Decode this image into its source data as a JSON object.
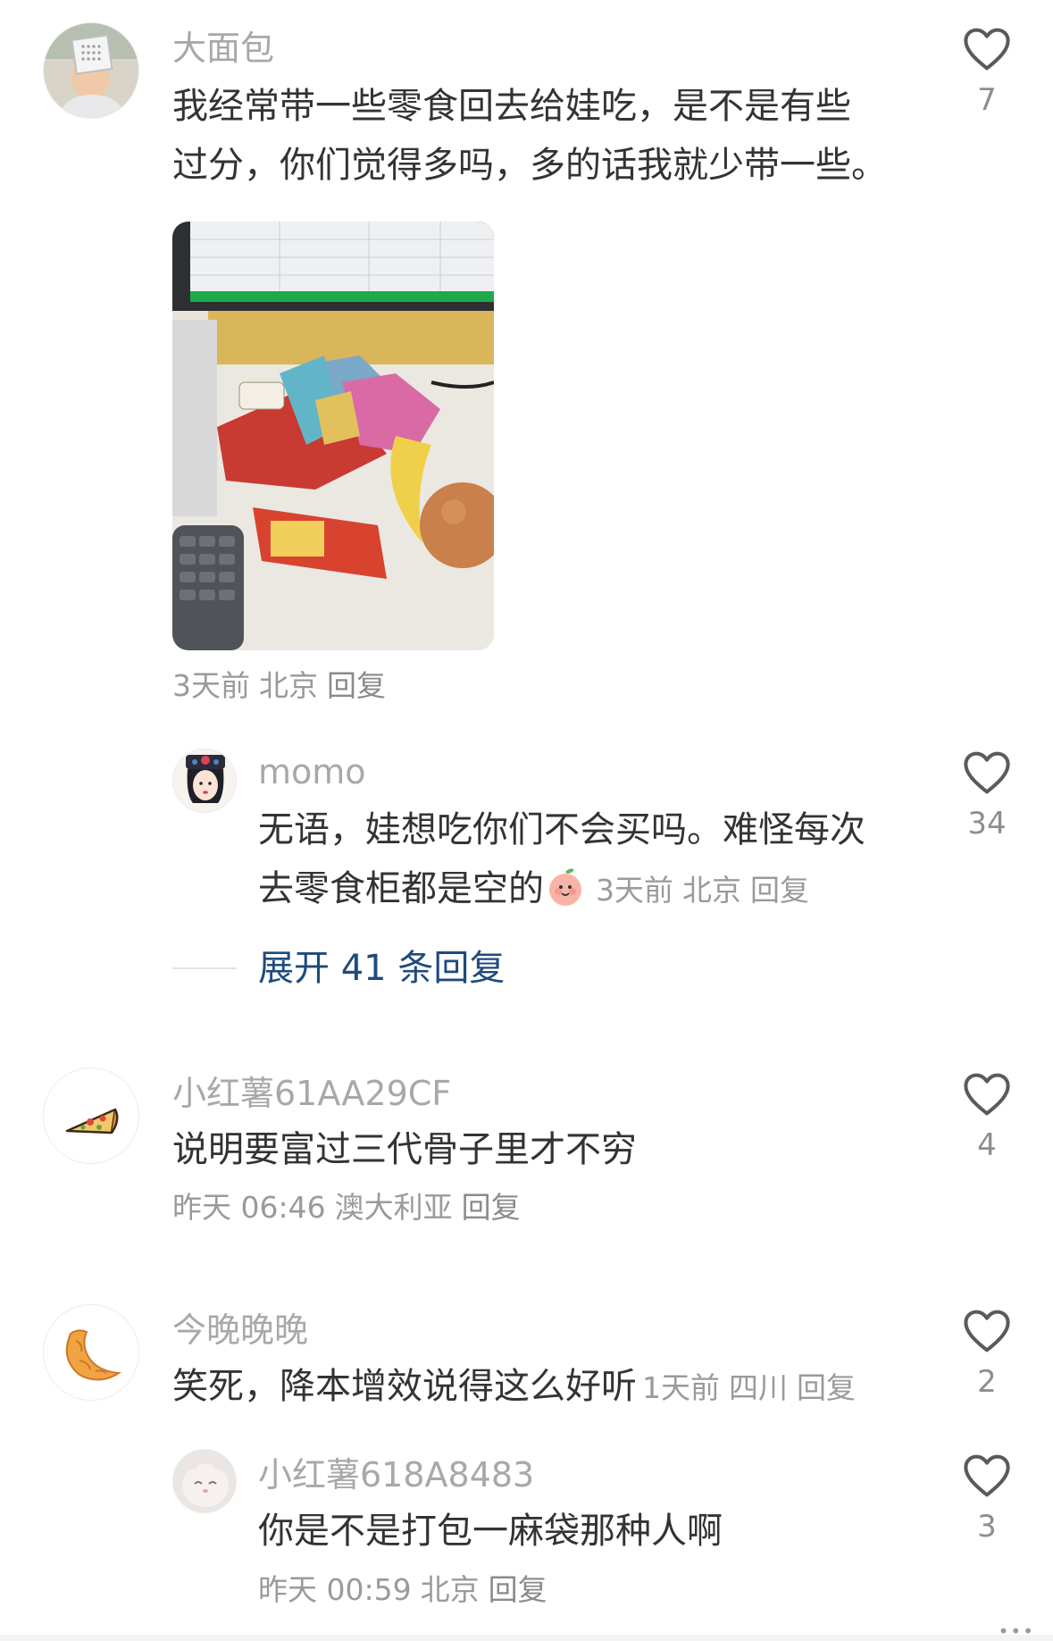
{
  "comments": [
    {
      "username": "大面包",
      "text_line1": "我经常带一些零食回去给娃吃，是不是有些",
      "text_line2": "过分，你们觉得多吗，多的话我就少带一些。",
      "time": "3天前",
      "location": "北京",
      "reply": "回复",
      "likes": "7"
    },
    {
      "username": "momo",
      "text_line1": "无语，娃想吃你们不会买吗。难怪每次",
      "text_line2": "去零食柜都是空的",
      "time": "3天前",
      "location": "北京",
      "reply": "回复",
      "likes": "34"
    },
    {
      "username": "小红薯61AA29CF",
      "text": "说明要富过三代骨子里才不穷",
      "time": "昨天 06:46",
      "location": "澳大利亚",
      "reply": "回复",
      "likes": "4"
    },
    {
      "username": "今晚晚晚",
      "text": "笑死，降本增效说得这么好听",
      "time": "1天前",
      "location": "四川",
      "reply": "回复",
      "likes": "2"
    },
    {
      "username": "小红薯618A8483",
      "text": "你是不是打包一麻袋那种人啊",
      "time": "昨天 00:59",
      "location": "北京",
      "reply": "回复",
      "likes": "3"
    }
  ],
  "expand_replies": "展开 41 条回复",
  "colors": {
    "username": "#a8a8a8",
    "text": "#333333",
    "meta": "#9a9a9a",
    "expand": "#1f4a7c",
    "heart": "#5a5a5a"
  },
  "icons": {
    "like": "heart-outline-icon",
    "avatar2_emoji": "peach-emoji-icon",
    "avatar3": "pizza-icon",
    "avatar4": "croissant-icon"
  }
}
